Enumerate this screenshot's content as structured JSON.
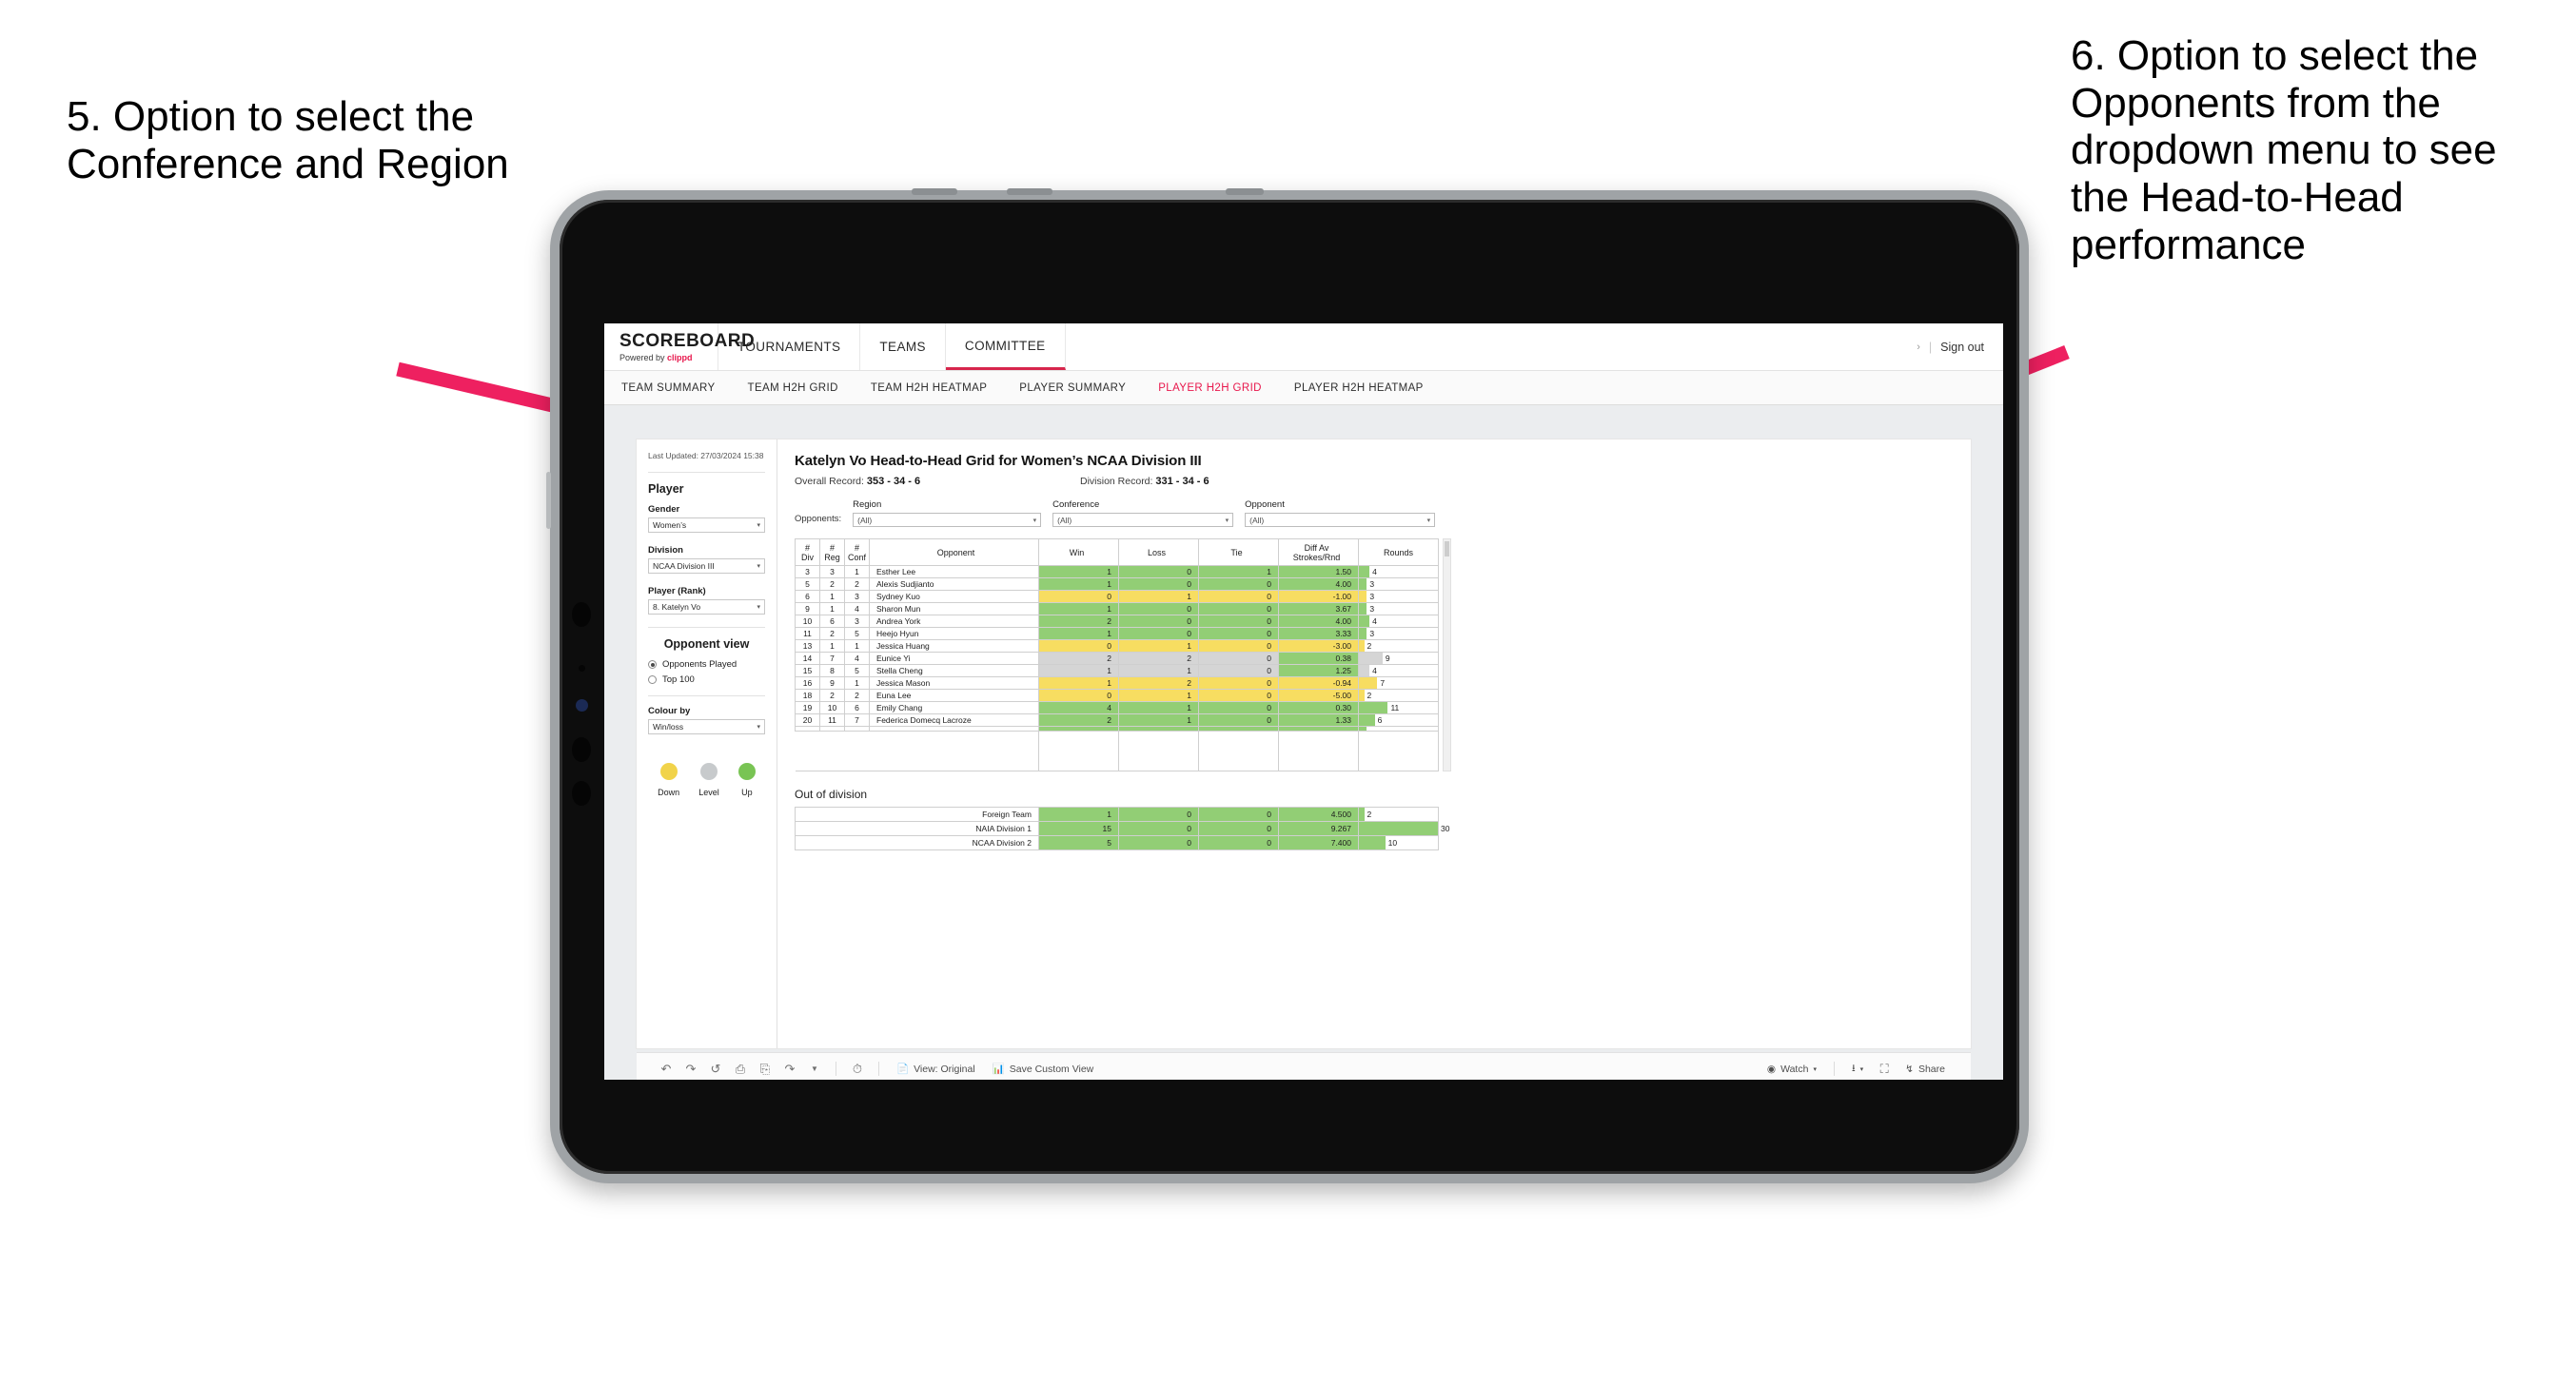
{
  "annotations": {
    "left": "5. Option to select the Conference and Region",
    "right": "6. Option to select the Opponents from the dropdown menu to see the Head-to-Head performance",
    "arrow_color": "#EE2060"
  },
  "topnav": {
    "brand_title": "SCOREBOARD",
    "brand_powered_prefix": "Powered by ",
    "brand_powered_name": "clippd",
    "items": [
      {
        "label": "TOURNAMENTS",
        "active": false
      },
      {
        "label": "TEAMS",
        "active": false
      },
      {
        "label": "COMMITTEE",
        "active": true
      }
    ],
    "caret": "›",
    "divider": "|",
    "signout": "Sign out"
  },
  "subnav": {
    "items": [
      {
        "label": "TEAM SUMMARY",
        "active": false
      },
      {
        "label": "TEAM H2H GRID",
        "active": false
      },
      {
        "label": "TEAM H2H HEATMAP",
        "active": false
      },
      {
        "label": "PLAYER SUMMARY",
        "active": false
      },
      {
        "label": "PLAYER H2H GRID",
        "active": true
      },
      {
        "label": "PLAYER H2H HEATMAP",
        "active": false
      }
    ],
    "active_color": "#E8174C"
  },
  "sidebar": {
    "last_updated": "Last Updated: 27/03/2024 15:38",
    "player_heading": "Player",
    "fields": [
      {
        "label": "Gender",
        "value": "Women’s"
      },
      {
        "label": "Division",
        "value": "NCAA Division III"
      },
      {
        "label": "Player (Rank)",
        "value": "8. Katelyn Vo"
      }
    ],
    "opponent_view_heading": "Opponent view",
    "opponent_view_options": [
      {
        "label": "Opponents Played",
        "selected": true
      },
      {
        "label": "Top 100",
        "selected": false
      }
    ],
    "colour_by_label": "Colour by",
    "colour_by_value": "Win/loss",
    "legend": [
      {
        "label": "Down",
        "color": "#F1D34A"
      },
      {
        "label": "Level",
        "color": "#C7CACC"
      },
      {
        "label": "Up",
        "color": "#79C454"
      }
    ],
    "caret": "▾"
  },
  "main": {
    "title": "Katelyn Vo Head-to-Head Grid for Women’s NCAA Division III",
    "overall_record_label": "Overall Record: ",
    "overall_record_value": "353 -  34 - 6",
    "division_record_label": "Division Record: ",
    "division_record_value": "331 -  34 - 6",
    "filters_label": "Opponents:",
    "filters": [
      {
        "label": "Region",
        "value": "(All)"
      },
      {
        "label": "Conference",
        "value": "(All)"
      },
      {
        "label": "Opponent",
        "value": "(All)"
      }
    ],
    "filter_caret": "▾"
  },
  "table": {
    "headers": {
      "div": "# Div",
      "div_l1": "#",
      "div_l2": "Div",
      "reg_l1": "#",
      "reg_l2": "Reg",
      "conf_l1": "#",
      "conf_l2": "Conf",
      "opponent": "Opponent",
      "win": "Win",
      "loss": "Loss",
      "tie": "Tie",
      "diff_l1": "Diff Av",
      "diff_l2": "Strokes/Rnd",
      "rounds": "Rounds"
    },
    "max_rounds": 30,
    "rows": [
      {
        "div": "3",
        "reg": "3",
        "conf": "1",
        "opponent": "Esther Lee",
        "win": "1",
        "loss": "0",
        "tie": "1",
        "diff": "1.50",
        "rounds": "4",
        "state": "up"
      },
      {
        "div": "5",
        "reg": "2",
        "conf": "2",
        "opponent": "Alexis Sudjianto",
        "win": "1",
        "loss": "0",
        "tie": "0",
        "diff": "4.00",
        "rounds": "3",
        "state": "up"
      },
      {
        "div": "6",
        "reg": "1",
        "conf": "3",
        "opponent": "Sydney Kuo",
        "win": "0",
        "loss": "1",
        "tie": "0",
        "diff": "-1.00",
        "rounds": "3",
        "state": "down"
      },
      {
        "div": "9",
        "reg": "1",
        "conf": "4",
        "opponent": "Sharon Mun",
        "win": "1",
        "loss": "0",
        "tie": "0",
        "diff": "3.67",
        "rounds": "3",
        "state": "up"
      },
      {
        "div": "10",
        "reg": "6",
        "conf": "3",
        "opponent": "Andrea York",
        "win": "2",
        "loss": "0",
        "tie": "0",
        "diff": "4.00",
        "rounds": "4",
        "state": "up"
      },
      {
        "div": "11",
        "reg": "2",
        "conf": "5",
        "opponent": "Heejo Hyun",
        "win": "1",
        "loss": "0",
        "tie": "0",
        "diff": "3.33",
        "rounds": "3",
        "state": "up"
      },
      {
        "div": "13",
        "reg": "1",
        "conf": "1",
        "opponent": "Jessica Huang",
        "win": "0",
        "loss": "1",
        "tie": "0",
        "diff": "-3.00",
        "rounds": "2",
        "state": "down"
      },
      {
        "div": "14",
        "reg": "7",
        "conf": "4",
        "opponent": "Eunice Yi",
        "win": "2",
        "loss": "2",
        "tie": "0",
        "diff": "0.38",
        "rounds": "9",
        "state": "level",
        "diff_state": "up"
      },
      {
        "div": "15",
        "reg": "8",
        "conf": "5",
        "opponent": "Stella Cheng",
        "win": "1",
        "loss": "1",
        "tie": "0",
        "diff": "1.25",
        "rounds": "4",
        "state": "level",
        "diff_state": "up"
      },
      {
        "div": "16",
        "reg": "9",
        "conf": "1",
        "opponent": "Jessica Mason",
        "win": "1",
        "loss": "2",
        "tie": "0",
        "diff": "-0.94",
        "rounds": "7",
        "state": "down"
      },
      {
        "div": "18",
        "reg": "2",
        "conf": "2",
        "opponent": "Euna Lee",
        "win": "0",
        "loss": "1",
        "tie": "0",
        "diff": "-5.00",
        "rounds": "2",
        "state": "down"
      },
      {
        "div": "19",
        "reg": "10",
        "conf": "6",
        "opponent": "Emily Chang",
        "win": "4",
        "loss": "1",
        "tie": "0",
        "diff": "0.30",
        "rounds": "11",
        "state": "up"
      },
      {
        "div": "20",
        "reg": "11",
        "conf": "7",
        "opponent": "Federica Domecq Lacroze",
        "win": "2",
        "loss": "1",
        "tie": "0",
        "diff": "1.33",
        "rounds": "6",
        "state": "up"
      }
    ]
  },
  "out_of_division": {
    "title": "Out of division",
    "max_rounds": 30,
    "rows": [
      {
        "name": "Foreign Team",
        "win": "1",
        "loss": "0",
        "tie": "0",
        "diff": "4.500",
        "rounds": "2",
        "state": "up"
      },
      {
        "name": "NAIA Division 1",
        "win": "15",
        "loss": "0",
        "tie": "0",
        "diff": "9.267",
        "rounds": "30",
        "state": "up"
      },
      {
        "name": "NCAA Division 2",
        "win": "5",
        "loss": "0",
        "tie": "0",
        "diff": "7.400",
        "rounds": "10",
        "state": "up"
      }
    ]
  },
  "toolbar": {
    "view_label": "View: Original",
    "save_label": "Save Custom View",
    "watch_label": "Watch",
    "share_label": "Share",
    "caret": "▾"
  },
  "colors": {
    "up": "#92CE75",
    "down": "#F7DD61",
    "level": "#D5D5D5",
    "accent": "#E8174C"
  }
}
